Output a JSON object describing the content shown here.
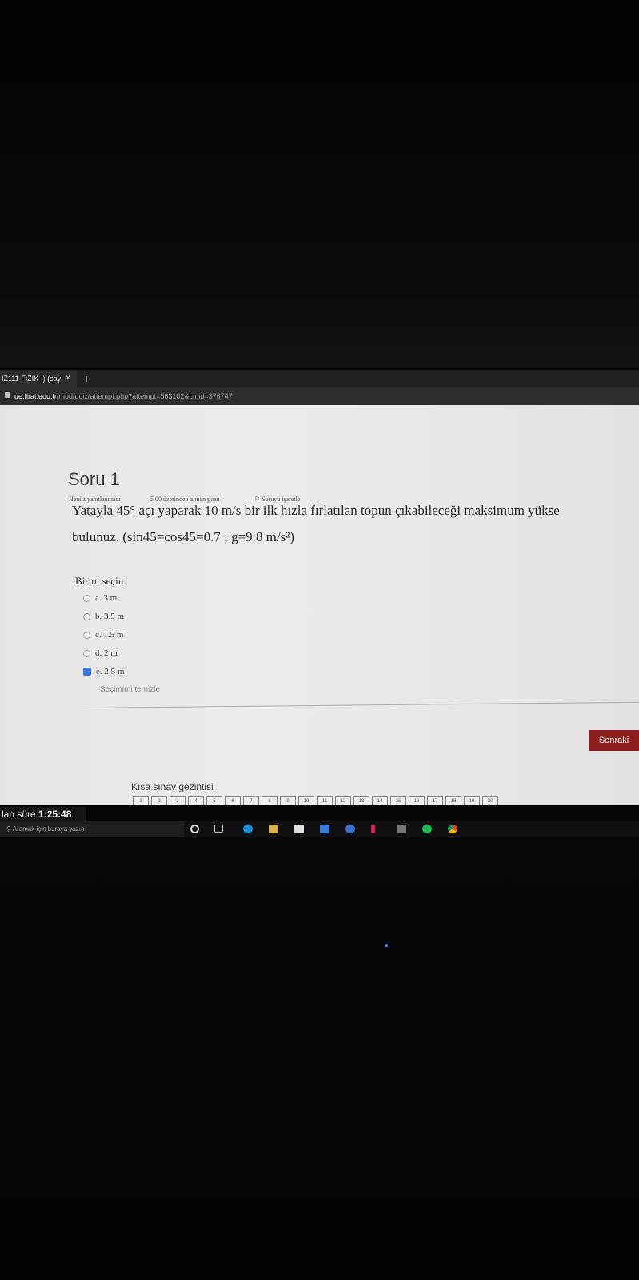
{
  "browser": {
    "tab_title": "IZ111 FİZİK-I) (say",
    "tab_close": "×",
    "new_tab": "+",
    "url_domain": "ue.firat.edu.tr",
    "url_path": "/mod/quiz/attempt.php?attempt=563102&cmid=376747"
  },
  "question": {
    "title": "Soru 1",
    "status": "Henüz yanıtlanmadı",
    "points": "5.00 üzerinden alınan puan",
    "flag": "Soruyu işaretle",
    "text_line1": "Yatayla 45° açı yaparak 10 m/s bir ilk hızla fırlatılan topun çıkabileceği maksimum yükse",
    "text_line2": "bulunuz. (sin45=cos45=0.7 ;  g=9.8 m/s²)",
    "choose_label": "Birini seçin:",
    "options": [
      {
        "label": "a. 3 m",
        "selected": false
      },
      {
        "label": "b. 3.5 m",
        "selected": false
      },
      {
        "label": "c. 1.5 m",
        "selected": false
      },
      {
        "label": "d. 2 m",
        "selected": false
      },
      {
        "label": "e. 2.5 m",
        "selected": true
      }
    ],
    "clear_choice": "Seçimimi temizle"
  },
  "next_button": "Sonraki",
  "navigation": {
    "title": "Kısa sınav gezintisi",
    "numbers": [
      "1",
      "2",
      "3",
      "4",
      "5",
      "6",
      "7",
      "8",
      "9",
      "10",
      "11",
      "12",
      "13",
      "14",
      "15",
      "16",
      "17",
      "18",
      "19",
      "20"
    ]
  },
  "timer": {
    "label": "lan süre",
    "value": "1:25:48"
  },
  "taskbar": {
    "search_placeholder": "Aramak için buraya yazın",
    "icons": [
      "cortana-icon",
      "task-view-icon",
      "edge-icon",
      "file-explorer-icon",
      "store-icon",
      "mail-icon",
      "app-icon",
      "app-icon-2",
      "calculator-icon",
      "spotify-icon",
      "chrome-icon"
    ]
  },
  "colors": {
    "next_button": "#8a1e1e",
    "selected_radio": "#3a76d6"
  }
}
